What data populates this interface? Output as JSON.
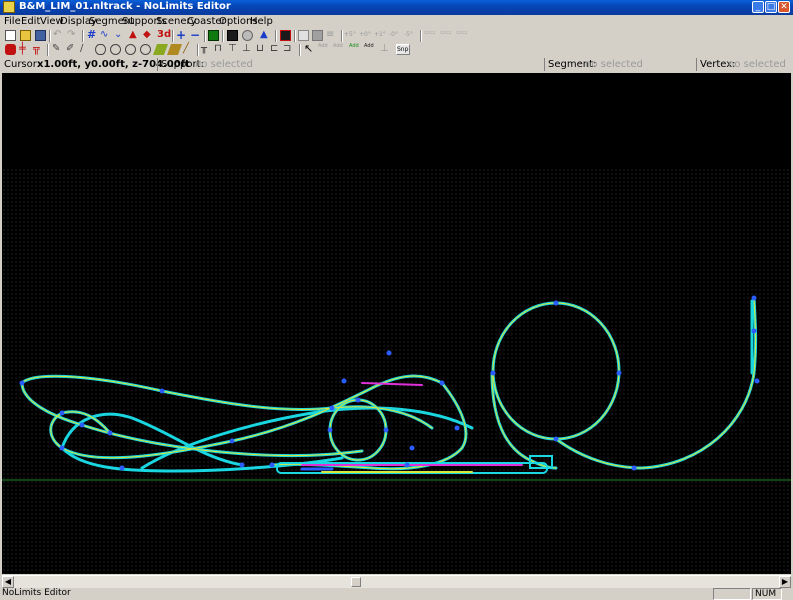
{
  "window": {
    "title": "B&M_LIM_01.nltrack - NoLimits Editor",
    "minimize_glyph": "_",
    "maximize_glyph": "□",
    "close_glyph": "✕"
  },
  "menu": [
    "File",
    "Edit",
    "View",
    "Display",
    "Segment",
    "Supports",
    "Scenery",
    "Coaster",
    "Options",
    "Help"
  ],
  "toolbar": {
    "snap_label": "Snp",
    "three_d_label": "3d",
    "angle_labels": [
      "+5°",
      "+0°",
      "+1°",
      "-0°",
      "-5°"
    ],
    "node_labels": [
      "Add",
      "Add",
      "Add",
      "Add"
    ]
  },
  "info_bar": {
    "cursor_label": "Cursor:",
    "cursor_value": "x1.00ft, y0.00ft, z-704.00ft",
    "support_label": "Support:",
    "support_value": "no selected",
    "segment_label": "Segment:",
    "segment_value": "no selected",
    "vertex_label": "Vertex:",
    "vertex_value": "no selected"
  },
  "statusbar": {
    "message": "NoLimits Editor",
    "num_indicator": "NUM"
  },
  "colors": {
    "track_cyan": "#19d6e0",
    "track_yellow": "#d8e83a",
    "track_blue": "#2a5cff",
    "track_magenta": "#e030d8",
    "ground_line": "#1e8a2a",
    "titlebar": "#0a4fcf"
  }
}
